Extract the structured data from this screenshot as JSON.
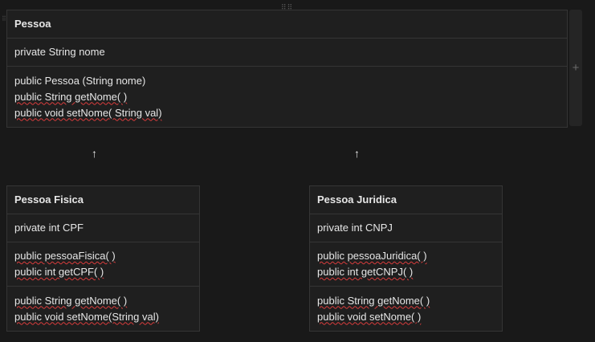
{
  "pessoa": {
    "title": "Pessoa",
    "attributes": [
      "private String nome"
    ],
    "methods": [
      "public Pessoa (String nome)",
      "public String getNome( )",
      "public void setNome( String val)"
    ]
  },
  "arrows": {
    "left": "↑",
    "right": "↑"
  },
  "fisica": {
    "title": "Pessoa Fisica",
    "attributes": [
      "private int CPF"
    ],
    "methods": [
      "public pessoaFisica( )",
      "public int getCPF( )"
    ],
    "inherited": [
      "public String getNome( )",
      "public void setNome(String val)"
    ]
  },
  "juridica": {
    "title": "Pessoa Juridica",
    "attributes": [
      "private int CNPJ"
    ],
    "methods": [
      "public pessoaJuridica( )",
      "public int getCNPJ( )"
    ],
    "inherited": [
      "public String getNome( )",
      "public void setNome( )"
    ]
  },
  "controls": {
    "add_column_icon": "+",
    "drag_handle": "⋮⋮"
  }
}
